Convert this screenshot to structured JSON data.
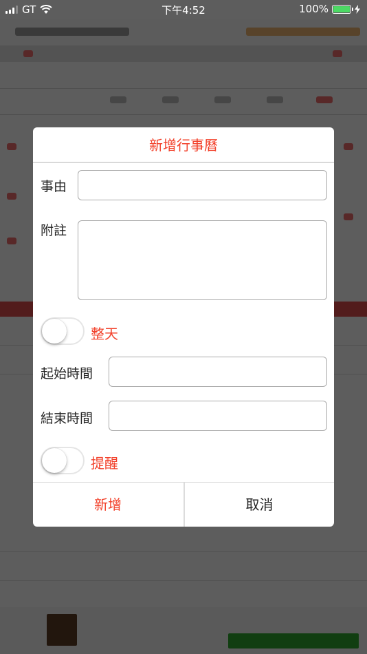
{
  "status_bar": {
    "carrier": "GT",
    "time": "下午4:52",
    "battery_percent": "100%",
    "signal_bars_on": 3,
    "signal_bars_total": 4
  },
  "dialog": {
    "title": "新增行事曆",
    "fields": {
      "subject_label": "事由",
      "subject_value": "",
      "note_label": "附註",
      "note_value": "",
      "start_time_label": "起始時間",
      "start_time_value": "",
      "end_time_label": "結束時間",
      "end_time_value": ""
    },
    "all_day": {
      "label": "整天",
      "on": false
    },
    "reminder": {
      "label": "提醒",
      "on": false
    },
    "buttons": {
      "add": "新增",
      "cancel": "取消"
    }
  },
  "colors": {
    "accent_red": "#f2402a",
    "battery_green": "#4cd964"
  }
}
